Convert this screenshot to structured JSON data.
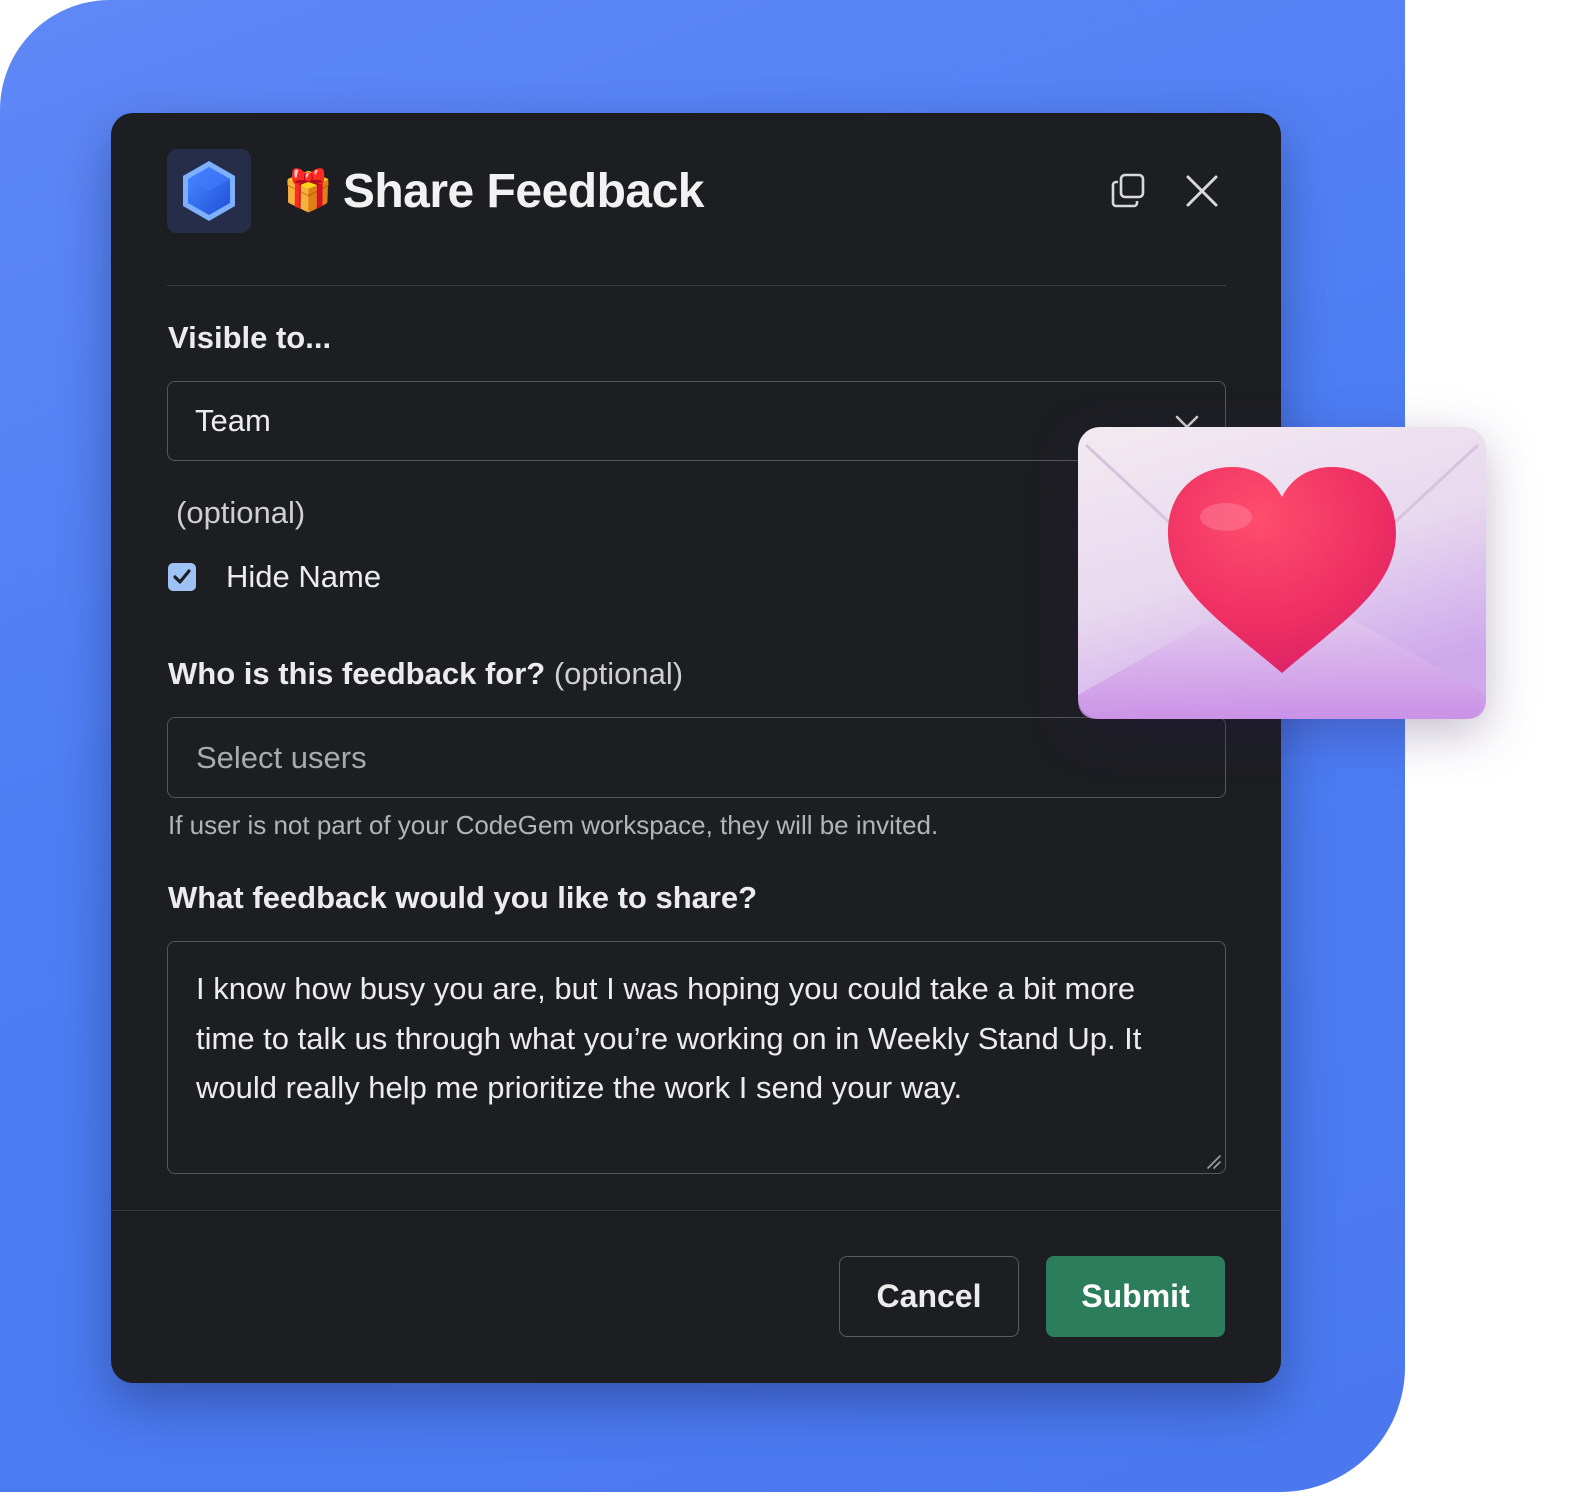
{
  "modal": {
    "title": "Share Feedback",
    "app_icon": "hexagon-icon",
    "title_emoji": "🎁",
    "copy_icon": "copy-icon",
    "close_icon": "close-icon"
  },
  "visibility": {
    "label": "Visible to...",
    "selected": "Team",
    "optional_note": "(optional)",
    "hide_name_label": "Hide Name",
    "hide_name_checked": true
  },
  "recipient": {
    "label": "Who is this feedback for?",
    "optional": "(optional)",
    "placeholder": "Select users",
    "hint": "If user is not part of your CodeGem workspace, they will be invited."
  },
  "feedback": {
    "label": "What feedback would you like to share?",
    "value": "I know how busy you are, but I was hoping you could take a bit more time to talk us through what you’re working on in Weekly Stand Up. It would really help me prioritize the work I send your way."
  },
  "actions": {
    "cancel": "Cancel",
    "submit": "Submit"
  },
  "colors": {
    "backdrop": "#5f88f6",
    "modal_bg": "#1d1e22",
    "submit": "#2c7d5b",
    "checkbox": "#9ec2f3"
  },
  "decor": {
    "envelope": "love-letter-icon"
  }
}
